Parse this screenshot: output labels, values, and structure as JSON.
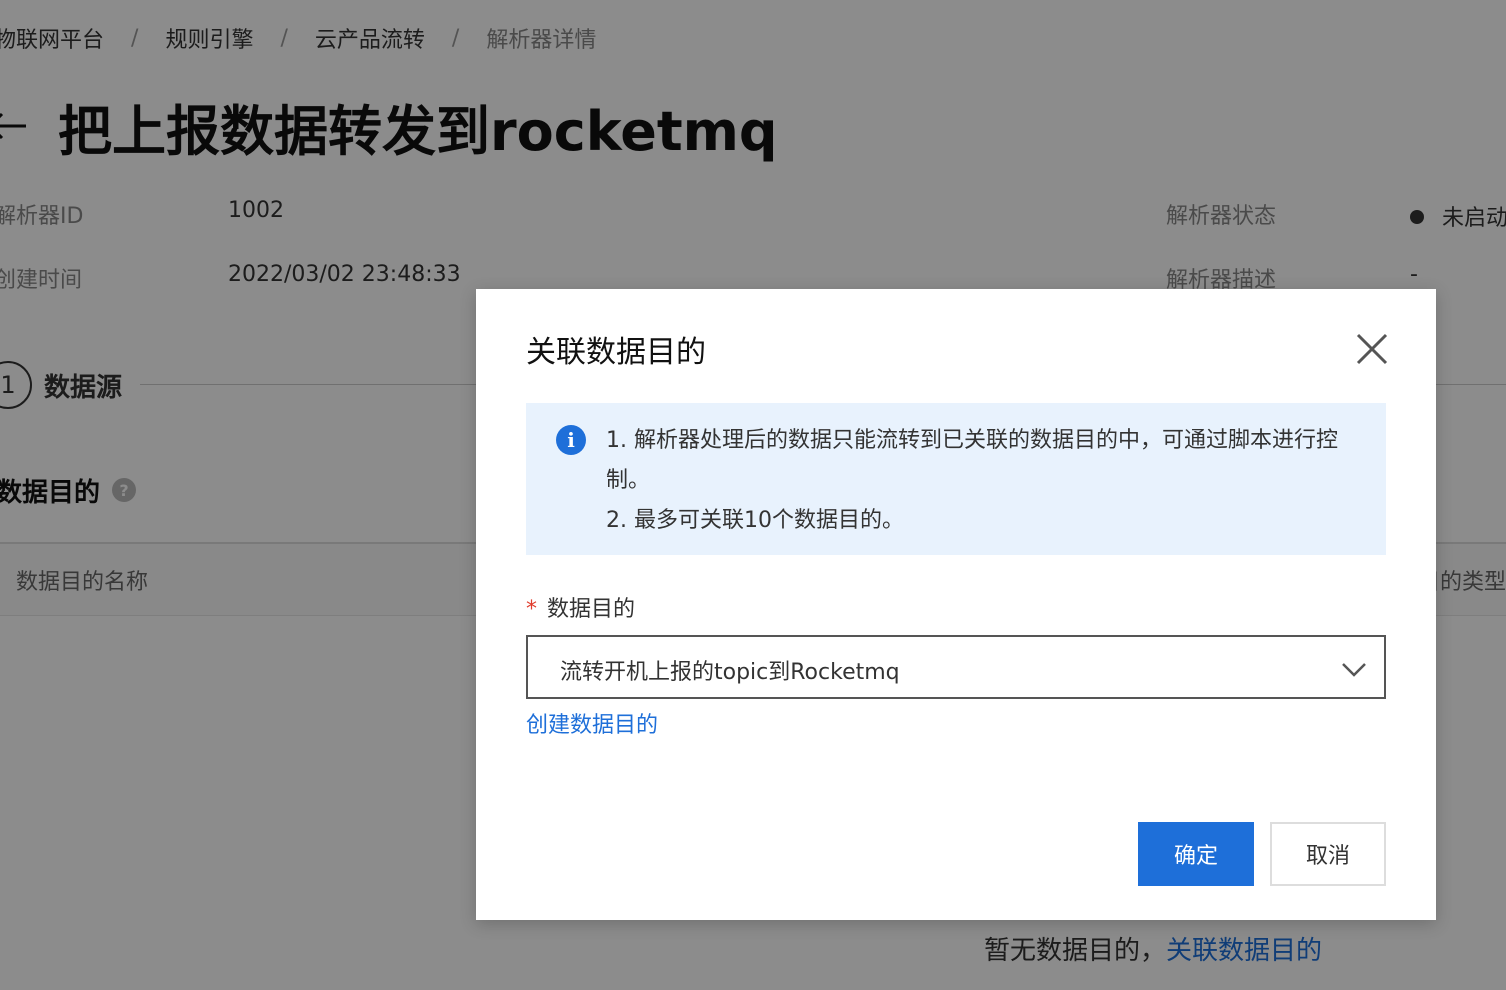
{
  "breadcrumb": {
    "items": [
      "物联网平台",
      "规则引擎",
      "云产品流转",
      "解析器详情"
    ],
    "separator": "/"
  },
  "page": {
    "title": "把上报数据转发到rocketmq"
  },
  "info": {
    "parser_id_label": "解析器ID",
    "parser_id_value": "1002",
    "created_label": "创建时间",
    "created_value": "2022/03/02 23:48:33",
    "status_label": "解析器状态",
    "status_value": "未启动",
    "desc_label": "解析器描述",
    "desc_value": "-"
  },
  "step": {
    "number": "1",
    "label": "数据源"
  },
  "section": {
    "title": "数据目的",
    "help_icon": "question-circle-icon"
  },
  "table": {
    "columns": [
      "数据目的名称",
      "数据目的类型"
    ]
  },
  "empty": {
    "text": "暂无数据目的，",
    "link": "关联数据目的"
  },
  "dialog": {
    "title": "关联数据目的",
    "close_icon": "close-icon",
    "notice": {
      "icon": "info-icon",
      "lines": [
        "1. 解析器处理后的数据只能流转到已关联的数据目的中，可通过脚本进行控制。",
        "2. 最多可关联10个数据目的。"
      ]
    },
    "field": {
      "required_mark": "*",
      "label": "数据目的",
      "selected_value": "流转开机上报的topic到Rocketmq",
      "chevron_icon": "chevron-down-icon"
    },
    "create_link": "创建数据目的",
    "confirm_label": "确定",
    "cancel_label": "取消"
  },
  "colors": {
    "primary": "#1e6fd9",
    "required": "#e03c2c",
    "notice_bg": "#e8f2fd",
    "mask": "rgba(0,0,0,0.45)"
  }
}
